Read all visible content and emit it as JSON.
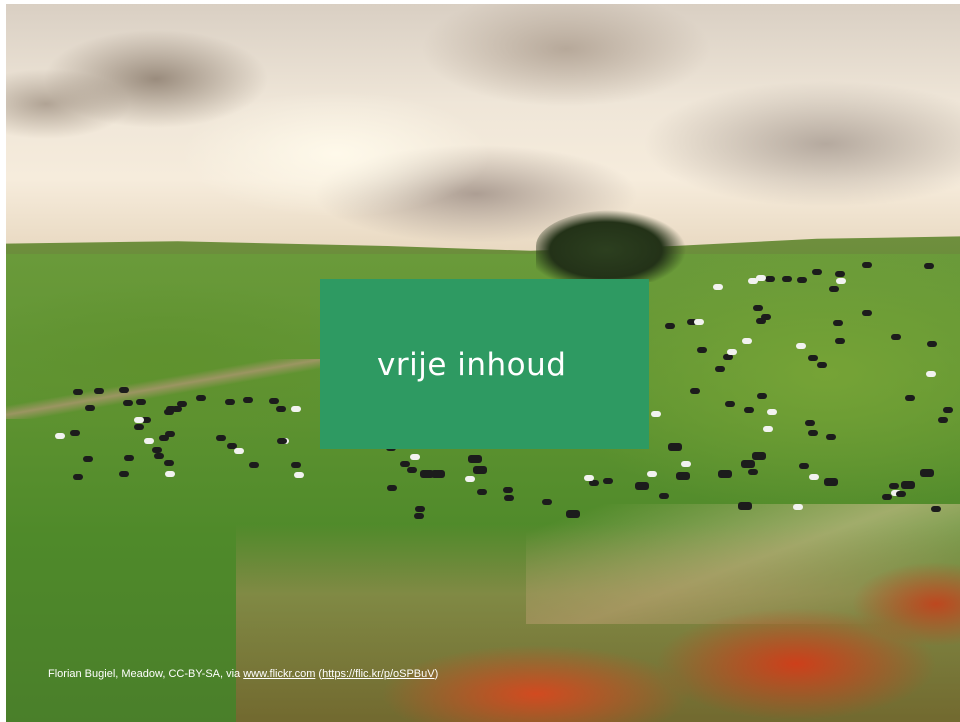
{
  "slide": {
    "title": "vrije inhoud",
    "title_box_color": "#2e9a62",
    "background_photo": {
      "subject": "green meadow with grazing cows, sunset sky, red flowers in foreground"
    }
  },
  "credit": {
    "prefix": "Florian Bugiel, Meadow, CC-BY-SA, via ",
    "site_link": "www.flickr.com",
    "open_paren": " (",
    "short_link": "https://flic.kr/p/oSPBuV",
    "close_paren": ")"
  }
}
